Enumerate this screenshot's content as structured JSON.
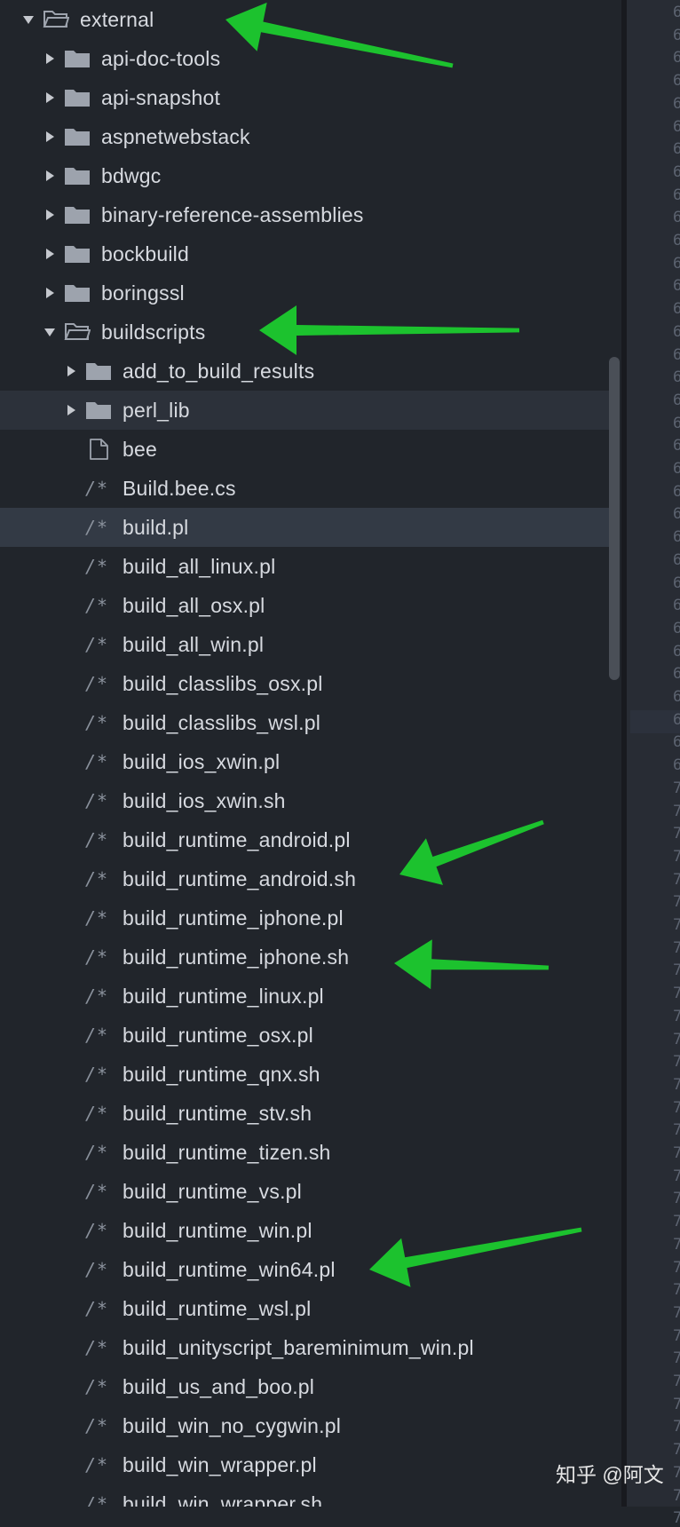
{
  "tree": [
    {
      "label": "external",
      "type": "folder",
      "state": "open",
      "depth": 0
    },
    {
      "label": "api-doc-tools",
      "type": "folder",
      "state": "closed",
      "depth": 1
    },
    {
      "label": "api-snapshot",
      "type": "folder",
      "state": "closed",
      "depth": 1
    },
    {
      "label": "aspnetwebstack",
      "type": "folder",
      "state": "closed",
      "depth": 1
    },
    {
      "label": "bdwgc",
      "type": "folder",
      "state": "closed",
      "depth": 1
    },
    {
      "label": "binary-reference-assemblies",
      "type": "folder",
      "state": "closed",
      "depth": 1
    },
    {
      "label": "bockbuild",
      "type": "folder",
      "state": "closed",
      "depth": 1
    },
    {
      "label": "boringssl",
      "type": "folder",
      "state": "closed",
      "depth": 1
    },
    {
      "label": "buildscripts",
      "type": "folder",
      "state": "open",
      "depth": 1
    },
    {
      "label": "add_to_build_results",
      "type": "folder",
      "state": "closed",
      "depth": 2
    },
    {
      "label": "perl_lib",
      "type": "folder",
      "state": "closed",
      "depth": 2,
      "hover": true
    },
    {
      "label": "bee",
      "type": "file",
      "depth": 2
    },
    {
      "label": "Build.bee.cs",
      "type": "code",
      "icon_text": "/*",
      "depth": 2
    },
    {
      "label": "build.pl",
      "type": "code",
      "icon_text": "/*",
      "depth": 2,
      "selected": true
    },
    {
      "label": "build_all_linux.pl",
      "type": "code",
      "icon_text": "/*",
      "depth": 2
    },
    {
      "label": "build_all_osx.pl",
      "type": "code",
      "icon_text": "/*",
      "depth": 2
    },
    {
      "label": "build_all_win.pl",
      "type": "code",
      "icon_text": "/*",
      "depth": 2
    },
    {
      "label": "build_classlibs_osx.pl",
      "type": "code",
      "icon_text": "/*",
      "depth": 2
    },
    {
      "label": "build_classlibs_wsl.pl",
      "type": "code",
      "icon_text": "/*",
      "depth": 2
    },
    {
      "label": "build_ios_xwin.pl",
      "type": "code",
      "icon_text": "/*",
      "depth": 2
    },
    {
      "label": "build_ios_xwin.sh",
      "type": "code",
      "icon_text": "/*",
      "depth": 2
    },
    {
      "label": "build_runtime_android.pl",
      "type": "code",
      "icon_text": "/*",
      "depth": 2
    },
    {
      "label": "build_runtime_android.sh",
      "type": "code",
      "icon_text": "/*",
      "depth": 2
    },
    {
      "label": "build_runtime_iphone.pl",
      "type": "code",
      "icon_text": "/*",
      "depth": 2
    },
    {
      "label": "build_runtime_iphone.sh",
      "type": "code",
      "icon_text": "/*",
      "depth": 2
    },
    {
      "label": "build_runtime_linux.pl",
      "type": "code",
      "icon_text": "/*",
      "depth": 2
    },
    {
      "label": "build_runtime_osx.pl",
      "type": "code",
      "icon_text": "/*",
      "depth": 2
    },
    {
      "label": "build_runtime_qnx.sh",
      "type": "code",
      "icon_text": "/*",
      "depth": 2
    },
    {
      "label": "build_runtime_stv.sh",
      "type": "code",
      "icon_text": "/*",
      "depth": 2
    },
    {
      "label": "build_runtime_tizen.sh",
      "type": "code",
      "icon_text": "/*",
      "depth": 2
    },
    {
      "label": "build_runtime_vs.pl",
      "type": "code",
      "icon_text": "/*",
      "depth": 2
    },
    {
      "label": "build_runtime_win.pl",
      "type": "code",
      "icon_text": "/*",
      "depth": 2
    },
    {
      "label": "build_runtime_win64.pl",
      "type": "code",
      "icon_text": "/*",
      "depth": 2
    },
    {
      "label": "build_runtime_wsl.pl",
      "type": "code",
      "icon_text": "/*",
      "depth": 2
    },
    {
      "label": "build_unityscript_bareminimum_win.pl",
      "type": "code",
      "icon_text": "/*",
      "depth": 2
    },
    {
      "label": "build_us_and_boo.pl",
      "type": "code",
      "icon_text": "/*",
      "depth": 2
    },
    {
      "label": "build_win_no_cygwin.pl",
      "type": "code",
      "icon_text": "/*",
      "depth": 2
    },
    {
      "label": "build_win_wrapper.pl",
      "type": "code",
      "icon_text": "/*",
      "depth": 2
    },
    {
      "label": "build_win_wrapper.sh",
      "type": "code",
      "icon_text": "/*",
      "depth": 2
    }
  ],
  "gutter_digits": [
    "6",
    "6",
    "6",
    "6",
    "6",
    "6",
    "6",
    "6",
    "6",
    "6",
    "6",
    "6",
    "6",
    "6",
    "6",
    "6",
    "6",
    "6",
    "6",
    "6",
    "6",
    "6",
    "6",
    "6",
    "6",
    "6",
    "6",
    "6",
    "6",
    "6",
    "6",
    "6",
    "6",
    "6",
    "7",
    "7",
    "7",
    "7",
    "7",
    "7",
    "7",
    "7",
    "7",
    "7",
    "7",
    "7",
    "7",
    "7",
    "7",
    "7",
    "7",
    "7",
    "7",
    "7",
    "7",
    "7",
    "7",
    "7",
    "7",
    "7",
    "7",
    "7",
    "7",
    "7",
    "7",
    "7",
    "7"
  ],
  "watermark": "知乎 @阿文",
  "colors": {
    "annotation_arrow": "#1cc22e",
    "background": "#21252b",
    "selected_row": "#333a45"
  },
  "annotation_arrow_targets": [
    "external",
    "buildscripts",
    "build_runtime_android.sh",
    "build_runtime_iphone.sh",
    "build_runtime_win64.pl"
  ]
}
